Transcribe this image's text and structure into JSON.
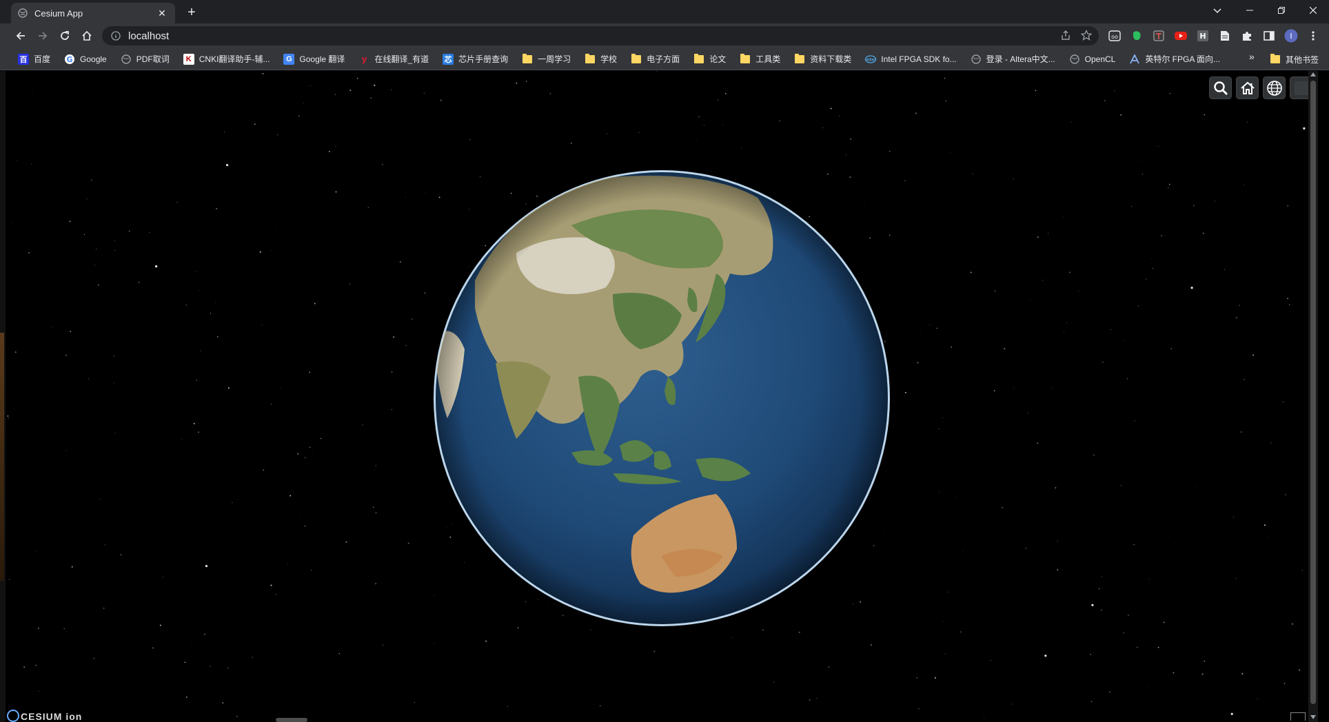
{
  "browser": {
    "tab": {
      "title": "Cesium App"
    },
    "address": {
      "url": "localhost"
    },
    "bookmarks": [
      {
        "label": "百度",
        "icon": "baidu-icon"
      },
      {
        "label": "Google",
        "icon": "google-icon"
      },
      {
        "label": "PDF取词",
        "icon": "globe-icon"
      },
      {
        "label": "CNKI翻译助手-辅...",
        "icon": "cnki-icon"
      },
      {
        "label": "Google 翻译",
        "icon": "google-translate-icon"
      },
      {
        "label": "在线翻译_有道",
        "icon": "youdao-icon"
      },
      {
        "label": "芯片手册查询",
        "icon": "chip-icon"
      },
      {
        "label": "一周学习",
        "icon": "folder-icon"
      },
      {
        "label": "学校",
        "icon": "folder-icon"
      },
      {
        "label": "电子方面",
        "icon": "folder-icon"
      },
      {
        "label": "论文",
        "icon": "folder-icon"
      },
      {
        "label": "工具类",
        "icon": "folder-icon"
      },
      {
        "label": "资料下载类",
        "icon": "folder-icon"
      },
      {
        "label": "Intel FPGA SDK fo...",
        "icon": "intel-icon"
      },
      {
        "label": "登录 - Altera中文...",
        "icon": "globe-icon"
      },
      {
        "label": "OpenCL",
        "icon": "globe-icon"
      },
      {
        "label": "英特尔 FPGA 面向...",
        "icon": "altera-icon"
      }
    ],
    "bookmarks_more": "»",
    "other_bookmarks": "其他书签",
    "profile_initial": "I"
  },
  "cesium": {
    "logo_text": "CESIUM ion"
  },
  "colors": {
    "tab_strip": "#202124",
    "toolbar": "#35363a",
    "cesium_button": "#303336",
    "folder": "#fdd663"
  }
}
